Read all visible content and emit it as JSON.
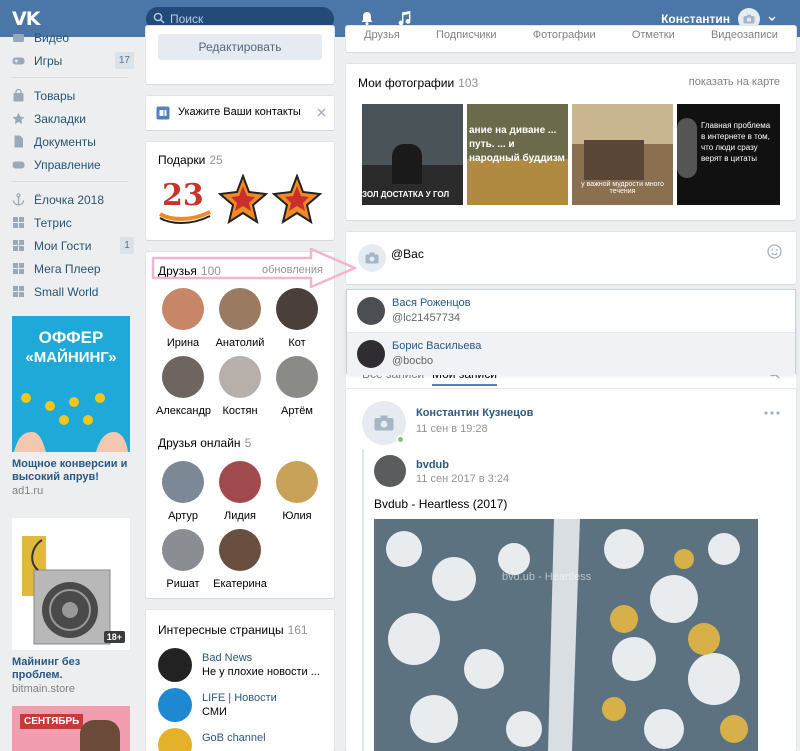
{
  "header": {
    "logo": "VK",
    "search_placeholder": "Поиск",
    "user_name": "Константин"
  },
  "leftnav": {
    "items": [
      {
        "label": "Видео",
        "icon": "video-icon"
      },
      {
        "label": "Игры",
        "icon": "gamepad-icon",
        "count": "17"
      },
      {
        "label": "Товары",
        "icon": "bag-icon"
      },
      {
        "label": "Закладки",
        "icon": "star-icon"
      },
      {
        "label": "Документы",
        "icon": "document-icon"
      },
      {
        "label": "Управление",
        "icon": "gamepad-icon"
      },
      {
        "label": "Ёлочка 2018",
        "icon": "anchor-icon"
      },
      {
        "label": "Тетрис",
        "icon": "grid-icon"
      },
      {
        "label": "Мои Гости",
        "icon": "grid-icon",
        "count": "1"
      },
      {
        "label": "Мега Плеер",
        "icon": "grid-icon"
      },
      {
        "label": "Small World",
        "icon": "grid-icon"
      }
    ],
    "ads": [
      {
        "banner_line1": "ОФФЕР",
        "banner_line2": "«МАЙНИНГ»",
        "title": "Мощное конверсии и высокий апрув!",
        "domain": "ad1.ru"
      },
      {
        "badge": "18+",
        "title": "Майнинг без проблем.",
        "domain": "bitmain.store"
      },
      {
        "banner_text": "СЕНТЯБРЬ"
      }
    ]
  },
  "middle": {
    "edit_button": "Редактировать",
    "contacts_prompt": "Укажите Ваши контакты",
    "gifts": {
      "title": "Подарки",
      "count": "25",
      "gift_number": "23"
    },
    "friends": {
      "title": "Друзья",
      "count": "100",
      "updates_link": "обновления",
      "list": [
        "Ирина",
        "Анатолий",
        "Кот",
        "Александр",
        "Костян",
        "Артём"
      ]
    },
    "friends_online": {
      "title": "Друзья онлайн",
      "count": "5",
      "list": [
        "Артур",
        "Лидия",
        "Юлия",
        "Ришат",
        "Екатерина"
      ]
    },
    "pages": {
      "title": "Интересные страницы",
      "count": "161",
      "list": [
        {
          "name": "Bad News",
          "desc": "Не у плохие новости ..."
        },
        {
          "name": "LIFE | Новости",
          "desc": "СМИ"
        },
        {
          "name": "GoB channel",
          "desc": ""
        }
      ]
    }
  },
  "right": {
    "top_tabs": [
      "Друзья",
      "Подписчики",
      "Фотографии",
      "Отметки",
      "Видеозаписи"
    ],
    "photos": {
      "title": "Мои фотографии",
      "count": "103",
      "map_link": "показать на карте",
      "captions": [
        "ЗОЛ ДОСТАТКА У ГОЛ",
        "ание на диване ... путь. ... и народный буддизм",
        "у важной мудрости много течения",
        "Главная проблема в интернете в том, что люди сразу верят в цитаты"
      ]
    },
    "composer": {
      "value": "@Вас"
    },
    "suggestions": [
      {
        "name": "Вася Роженцов",
        "handle": "@lc21457734"
      },
      {
        "name": "Борис Васильева",
        "handle": "@bocbo"
      }
    ],
    "feed_tabs": [
      "Все записи",
      "Мои записи"
    ],
    "post": {
      "author": "Константин Кузнецов",
      "date": "11 сен в 19:28",
      "repost_author": "bvdub",
      "repost_date": "11 сен 2017 в 3:24",
      "text": "Bvdub - Heartless (2017)",
      "watermark": "bvd.ub - Heartless"
    }
  },
  "colors": {
    "brand": "#4a76a8",
    "link": "#2a5885",
    "background": "#edeef0",
    "arrow": "#f4b3d0"
  }
}
